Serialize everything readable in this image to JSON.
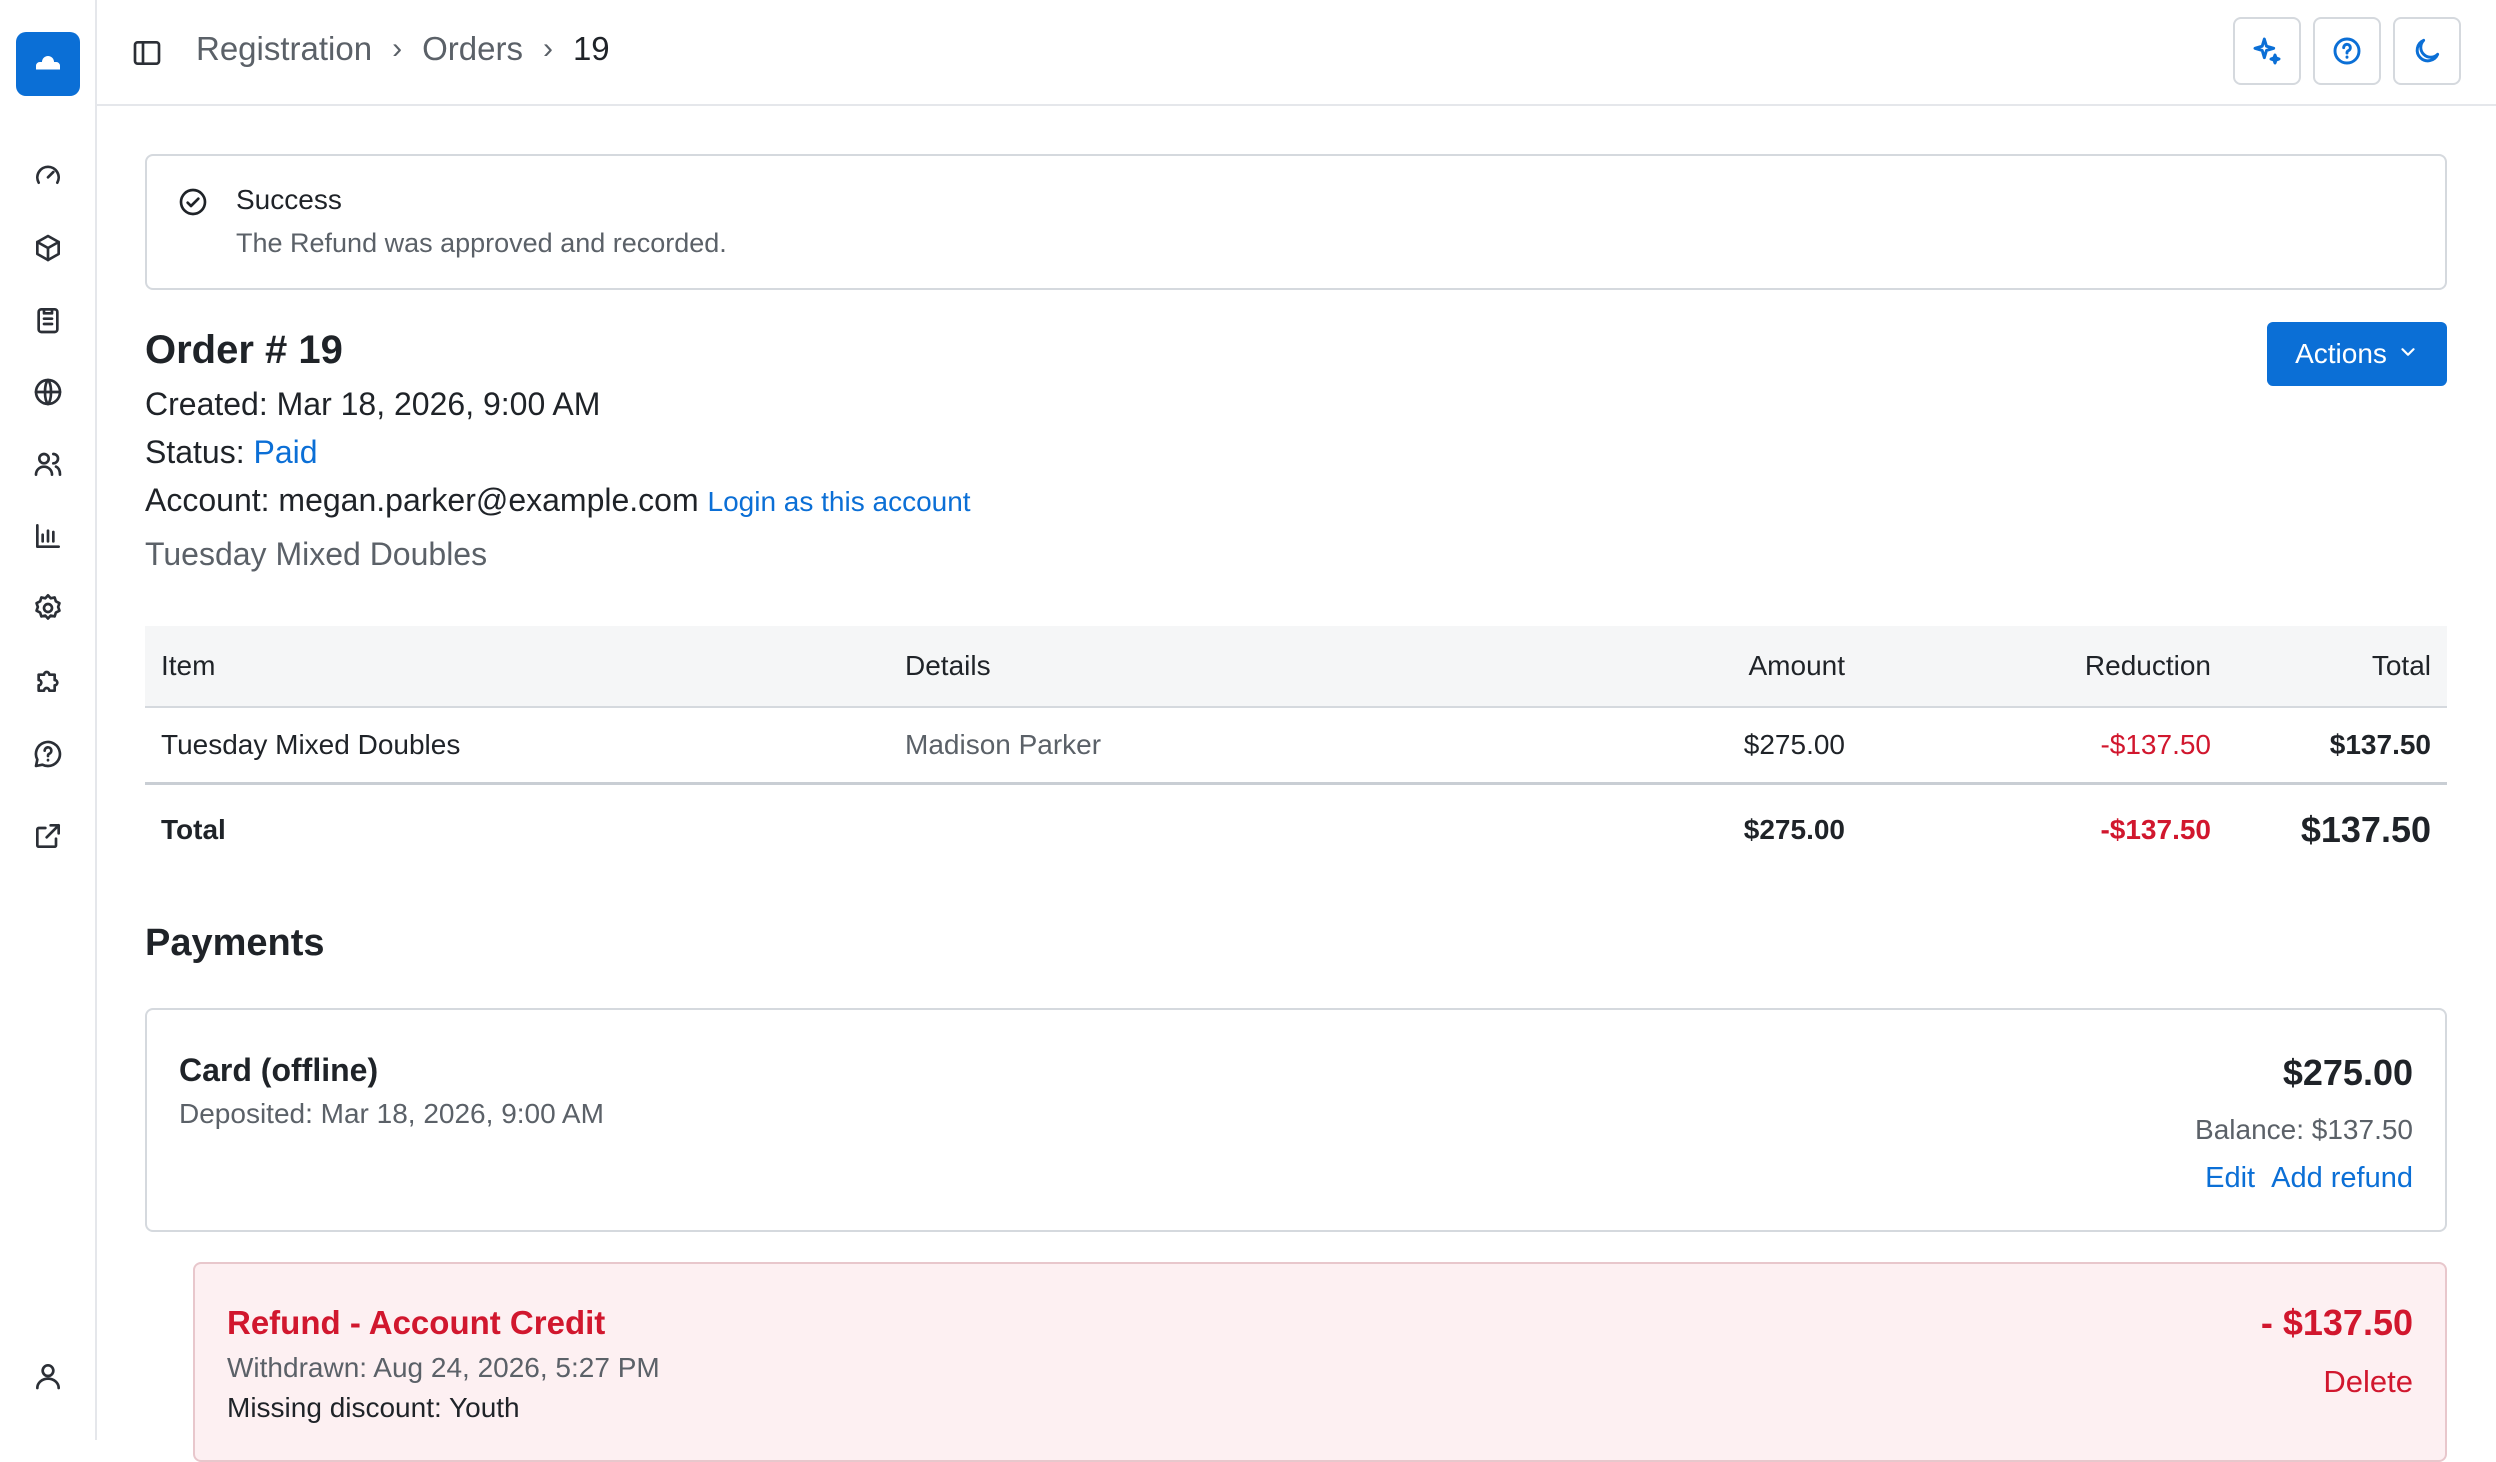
{
  "colors": {
    "accent": "#0b6fd6",
    "danger": "#d1172e",
    "muted": "#5b6168",
    "refund_bg": "#fdf0f2"
  },
  "sidebar": {
    "logo_icon": "cloud-icon",
    "items": [
      {
        "icon": "dashboard-gauge-icon"
      },
      {
        "icon": "box-icon"
      },
      {
        "icon": "clipboard-icon"
      },
      {
        "icon": "globe-icon"
      },
      {
        "icon": "users-icon"
      },
      {
        "icon": "bar-chart-icon"
      },
      {
        "icon": "gear-icon"
      },
      {
        "icon": "puzzle-icon"
      },
      {
        "icon": "help-circle-icon"
      },
      {
        "icon": "external-link-icon"
      }
    ],
    "bottom_icon": "user-icon"
  },
  "breadcrumb": {
    "items": [
      "Registration",
      "Orders"
    ],
    "current": "19",
    "separator": "›"
  },
  "top_buttons": [
    "sparkle-icon",
    "help-circle-icon",
    "moon-icon"
  ],
  "alert": {
    "title": "Success",
    "message": "The Refund was approved and recorded.",
    "icon": "check-circle-icon"
  },
  "order": {
    "title": "Order # 19",
    "created_label": "Created:",
    "created_value": "Mar 18, 2026, 9:00 AM",
    "status_label": "Status:",
    "status_value": "Paid",
    "account_label": "Account:",
    "account_value": "megan.parker@example.com",
    "login_link": "Login as this account",
    "program": "Tuesday Mixed Doubles",
    "actions_label": "Actions"
  },
  "table": {
    "headers": {
      "item": "Item",
      "details": "Details",
      "amount": "Amount",
      "reduction": "Reduction",
      "total": "Total"
    },
    "rows": [
      {
        "item": "Tuesday Mixed Doubles",
        "details": "Madison Parker",
        "amount": "$275.00",
        "reduction": "-$137.50",
        "total": "$137.50"
      }
    ],
    "footer": {
      "label": "Total",
      "amount": "$275.00",
      "reduction": "-$137.50",
      "total": "$137.50"
    }
  },
  "payments": {
    "title": "Payments",
    "card": {
      "title": "Card (offline)",
      "deposited": "Deposited: Mar 18, 2026, 9:00 AM",
      "amount": "$275.00",
      "balance": "Balance: $137.50",
      "edit": "Edit",
      "add_refund": "Add refund"
    },
    "refund": {
      "title": "Refund - Account Credit",
      "withdrawn": "Withdrawn: Aug 24, 2026, 5:27 PM",
      "note": "Missing discount: Youth",
      "amount": "- $137.50",
      "delete": "Delete"
    }
  }
}
